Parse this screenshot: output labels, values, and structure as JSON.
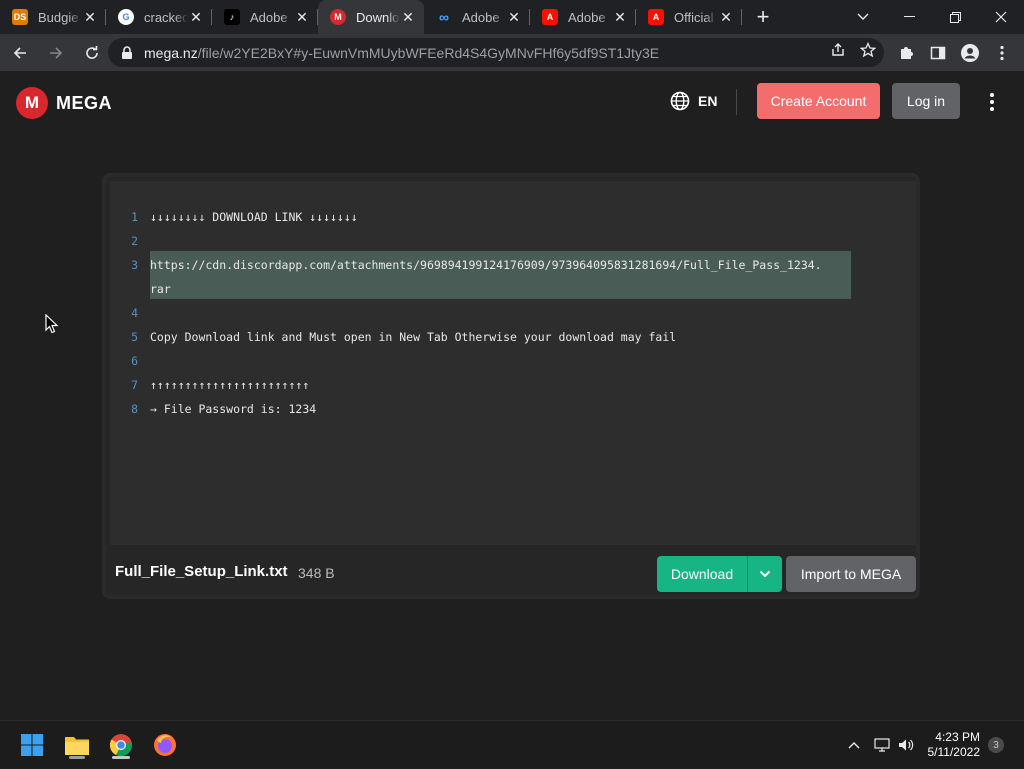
{
  "browser": {
    "tabs": [
      {
        "title": "Budgie",
        "favicon": "budgie-favicon",
        "color": "#e07a00",
        "glyph": "DS"
      },
      {
        "title": "cracked",
        "favicon": "google-favicon",
        "color": "#ffffff",
        "glyph": "G"
      },
      {
        "title": "Adobe",
        "favicon": "tiktok-favicon",
        "color": "#000000",
        "glyph": "♪"
      },
      {
        "title": "Downlo",
        "favicon": "mega-favicon",
        "color": "#d9272e",
        "glyph": "M",
        "active": true
      },
      {
        "title": "Adobe",
        "favicon": "creative-cloud-favicon",
        "color": "#1473e6",
        "glyph": "∞"
      },
      {
        "title": "Adobe",
        "favicon": "adobe-favicon",
        "color": "#fa0f00",
        "glyph": "A"
      },
      {
        "title": "Official",
        "favicon": "adobe-favicon",
        "color": "#fa0f00",
        "glyph": "A"
      }
    ],
    "url_host": "mega.nz",
    "url_path": "/file/w2YE2BxY#y-EuwnVmMUybWFEeRd4S4GyMNvFHf6y5df9ST1Jty3E"
  },
  "header": {
    "logo_letter": "M",
    "logo_text": "MEGA",
    "language": "EN",
    "create_account": "Create Account",
    "login": "Log in"
  },
  "file": {
    "lines": [
      {
        "num": "1",
        "text": "↓↓↓↓↓↓↓↓ DOWNLOAD LINK ↓↓↓↓↓↓↓"
      },
      {
        "num": "2",
        "text": ""
      },
      {
        "num": "3",
        "text": "https://cdn.discordapp.com/attachments/969894199124176909/973964095831281694/Full_File_Pass_1234."
      },
      {
        "num": "",
        "text": "rar"
      },
      {
        "num": "4",
        "text": ""
      },
      {
        "num": "5",
        "text": "Copy Download link and Must open in New Tab Otherwise your download may fail"
      },
      {
        "num": "6",
        "text": ""
      },
      {
        "num": "7",
        "text": "↑↑↑↑↑↑↑↑↑↑↑↑↑↑↑↑↑↑↑↑↑↑↑"
      },
      {
        "num": "8",
        "text": "→ File Password is: 1234"
      }
    ],
    "name": "Full_File_Setup_Link.txt",
    "size": "348 B",
    "download": "Download",
    "import": "Import to MEGA"
  },
  "taskbar": {
    "time": "4:23 PM",
    "date": "5/11/2022",
    "notification_count": "3"
  },
  "colors": {
    "mega_red": "#d9272e",
    "create_account": "#f46d6d",
    "download_green": "#17b584",
    "selection": "#4a5c56"
  }
}
